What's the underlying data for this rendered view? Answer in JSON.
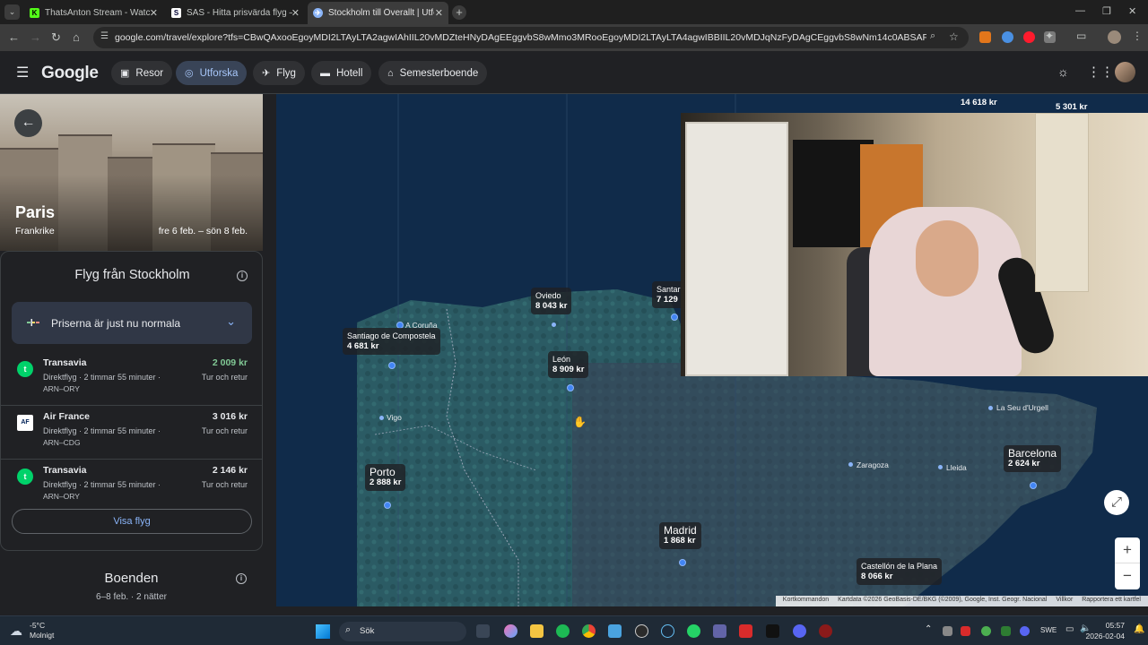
{
  "browser": {
    "tabs": [
      {
        "title": "ThatsAnton Stream - Watch Liv",
        "icon": "kick-icon",
        "color": "#53fc18"
      },
      {
        "title": "SAS - Hitta prisvärda flyg – Bok",
        "icon": "sas-icon",
        "color": "#ffffff"
      },
      {
        "title": "Stockholm till Överallt | Utforsk",
        "icon": "google-travel-icon",
        "color": "#8ab4f8"
      }
    ],
    "url": "google.com/travel/explore?tfs=CBwQAxooEgoyMDI2LTAyLTA2agwIAhIIL20vMDZteHNyDAgEEggvbS8wMmo3MRooEgoyMDI2LTAyLTA4agwIBBIIL20vMDJqNzFyDAgCEggvbS8wNm14c0ABSAFwAYIBCwj________88mAE..."
  },
  "header": {
    "logo": "Google",
    "nav": [
      "Resor",
      "Utforska",
      "Flyg",
      "Hotell",
      "Semesterboende"
    ],
    "active": "Utforska"
  },
  "destination": {
    "city": "Paris",
    "country": "Frankrike",
    "dates": "fre 6 feb. – sön 8 feb."
  },
  "flights": {
    "title": "Flyg från Stockholm",
    "price_status": "Priserna är just nu normala",
    "items": [
      {
        "airline": "Transavia",
        "detail": "Direktflyg · 2 timmar 55 minuter ·",
        "route": "ARN–ORY",
        "price": "2 009 kr",
        "type": "Tur och retur"
      },
      {
        "airline": "Air France",
        "detail": "Direktflyg · 2 timmar 55 minuter ·",
        "route": "ARN–CDG",
        "price": "3 016 kr",
        "type": "Tur och retur"
      },
      {
        "airline": "Transavia",
        "detail": "Direktflyg · 2 timmar 55 minuter ·",
        "route": "ARN–ORY",
        "price": "2 146 kr",
        "type": "Tur och retur"
      }
    ],
    "show_button": "Visa flyg"
  },
  "stays": {
    "title": "Boenden",
    "subtitle": "6–8 feb. · 2 nätter"
  },
  "map": {
    "price_labels": [
      {
        "name": "Oviedo",
        "price": "8 043 kr"
      },
      {
        "name": "Santiago de Compostela",
        "price": "4 681 kr"
      },
      {
        "name": "León",
        "price": "8 909 kr"
      },
      {
        "name": "Porto",
        "price": "2 888 kr"
      },
      {
        "name": "Madrid",
        "price": "1 868 kr"
      },
      {
        "name": "Barcelona",
        "price": "2 624 kr"
      },
      {
        "name": "Castellón de la Plana",
        "price": "8 066 kr"
      },
      {
        "name": "Santar",
        "price": "7 129"
      }
    ],
    "top_prices": [
      "14 618 kr",
      "5 301 kr"
    ],
    "places": [
      "A Coruña",
      "Vigo",
      "Zaragoza",
      "Lleida",
      "La Seu d'Urgell"
    ],
    "attribution": [
      "Kortkommandon",
      "Kartdata ©2026 GeoBasis-DE/BKG (©2009), Google, Inst. Geogr. Nacional",
      "Villkor",
      "Rapportera ett kartfel"
    ]
  },
  "taskbar": {
    "temp": "-5°C",
    "weather": "Molnigt",
    "search": "Sök",
    "lang": "SWE",
    "time": "05:57",
    "date": "2026-02-04"
  },
  "colors": {
    "accent": "#8ab4f8",
    "price_green": "#81c995",
    "map_water": "#102b4a",
    "map_land": "#2a5a63"
  }
}
